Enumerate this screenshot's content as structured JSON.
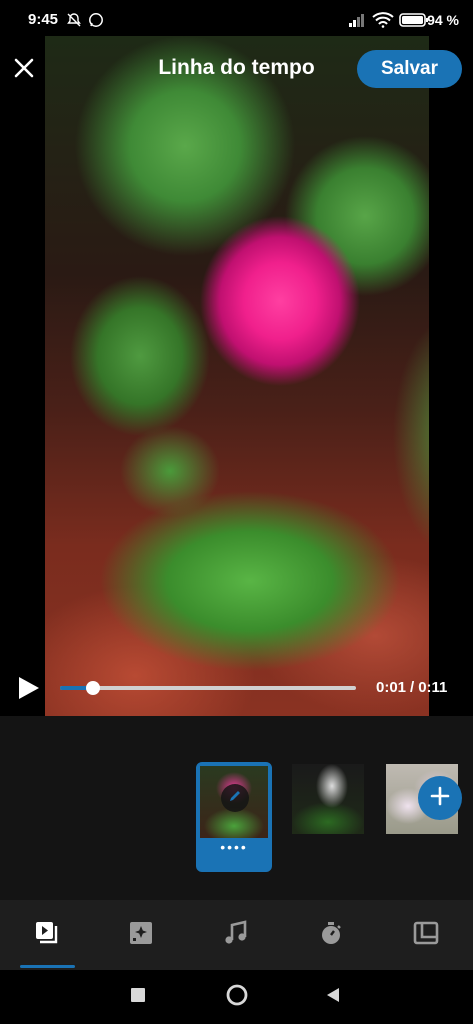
{
  "status_bar": {
    "time": "9:45",
    "icons": [
      "notifications-muted-icon",
      "whatsapp-icon",
      "signal-icon",
      "wifi-icon",
      "battery-icon"
    ],
    "battery_percent": "94 %"
  },
  "header": {
    "title": "Linha do tempo",
    "save_label": "Salvar",
    "close_icon": "close-icon"
  },
  "player": {
    "current_time": "0:01",
    "separator": "/",
    "total_time": "0:11",
    "progress_fraction": 0.11
  },
  "timeline": {
    "clips": [
      {
        "name": "clip-1",
        "selected": true
      },
      {
        "name": "clip-2",
        "selected": false
      },
      {
        "name": "clip-3",
        "selected": false
      }
    ],
    "more_indicator": "••••",
    "add_icon": "plus-icon"
  },
  "tabs": [
    {
      "icon": "clips-icon",
      "active": true
    },
    {
      "icon": "effects-icon",
      "active": false
    },
    {
      "icon": "music-icon",
      "active": false
    },
    {
      "icon": "timer-icon",
      "active": false
    },
    {
      "icon": "layout-icon",
      "active": false
    }
  ],
  "system_nav": [
    "recents-button",
    "home-button",
    "back-button"
  ],
  "colors": {
    "accent": "#1a73b5",
    "background": "#000000",
    "tabbar": "#1e1e1e"
  }
}
